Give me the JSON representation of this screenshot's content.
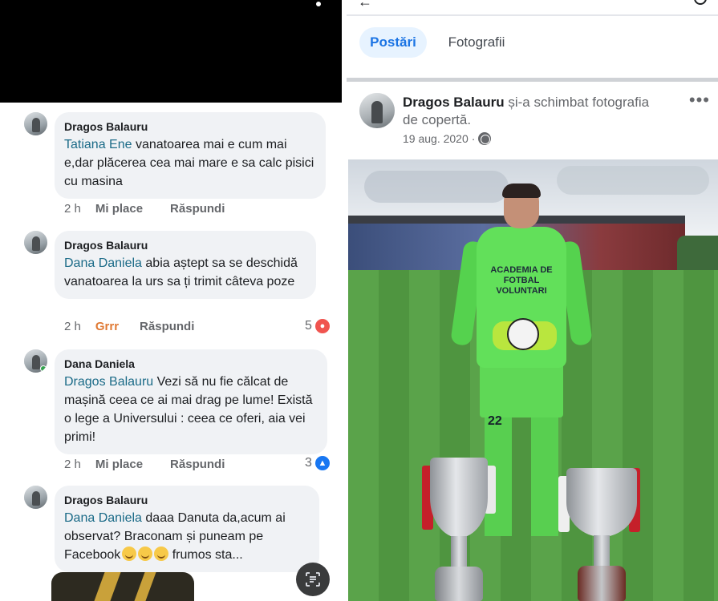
{
  "left_panel": {
    "comments": [
      {
        "author": "Dragos Balauru",
        "mention": "Tatiana Ene",
        "text": " vanatoarea mai e cum  mai e,dar plăcerea cea mai mare e sa calc pisici cu masina",
        "time": "2 h",
        "reaction_action": "Mi place",
        "reply": "Răspundi",
        "reaction_count": ""
      },
      {
        "author": "Dragos Balauru",
        "mention": "Dana Daniela",
        "text": " abia aștept sa se deschidă vanatoarea la urs sa ți trimit câteva poze",
        "time": "2 h",
        "reaction_action": "Grrr",
        "reply": "Răspundi",
        "reaction_count": "5"
      },
      {
        "author": "Dana Daniela",
        "mention": "Dragos Balauru",
        "text": " Vezi să nu fie călcat de mașină ceea ce ai mai drag pe lume! Există o lege a Universului : ceea ce oferi, aia vei primi!",
        "time": "2 h",
        "reaction_action": "Mi place",
        "reply": "Răspundi",
        "reaction_count": "3"
      },
      {
        "author": "Dragos Balauru",
        "mention": "Dana Daniela",
        "text_before_emoji": " daaa Danuta da,acum ai observat? Braconam  și puneam pe Facebook",
        "text_after_emoji": " frumos sta..."
      }
    ]
  },
  "right_panel": {
    "tabs": [
      {
        "label": "Postări",
        "active": true
      },
      {
        "label": "Fotografii",
        "active": false
      }
    ],
    "post": {
      "author": "Dragos Balauru",
      "action": "și-a schimbat fotografia de copertă.",
      "date": "19 aug. 2020",
      "more": "•••",
      "jersey_text": "ACADEMIA DE FOTBAL VOLUNTARI",
      "jersey_number": "22"
    }
  },
  "icons": {
    "privacy": "globe-icon",
    "scan": "text-scan-icon",
    "search": "search-icon",
    "back": "back-arrow-icon"
  },
  "colors": {
    "mention": "#1a6a87",
    "active_tab_bg": "#e7f3ff",
    "active_tab_text": "#1b74e4",
    "bubble_bg": "#f0f2f5",
    "grrr": "#e07a35"
  }
}
